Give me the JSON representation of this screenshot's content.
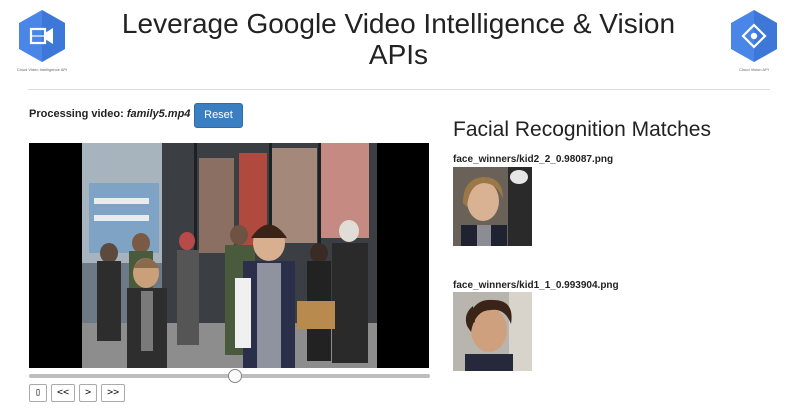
{
  "header": {
    "title": "Leverage Google Video Intelligence & Vision APIs",
    "left_logo": {
      "icon": "video-intelligence-hexagon-icon",
      "caption": "Cloud Video Intelligence API",
      "color": "#4a86e8"
    },
    "right_logo": {
      "icon": "vision-hexagon-icon",
      "caption": "Cloud Vision API",
      "color": "#4a86e8"
    }
  },
  "processing": {
    "prefix": "Processing video:",
    "filename": "family5.mp4",
    "reset_label": "Reset"
  },
  "player": {
    "progress": 0.51,
    "controls": {
      "play_pause": "▯",
      "rewind": "<<",
      "step": ">",
      "fast_forward": ">>"
    }
  },
  "matches": {
    "title": "Facial Recognition Matches",
    "items": [
      {
        "label": "face_winners/kid2_2_0.98087.png"
      },
      {
        "label": "face_winners/kid1_1_0.993904.png"
      }
    ]
  },
  "colors": {
    "accent": "#3a7fc1",
    "logo": "#4a86e8"
  }
}
